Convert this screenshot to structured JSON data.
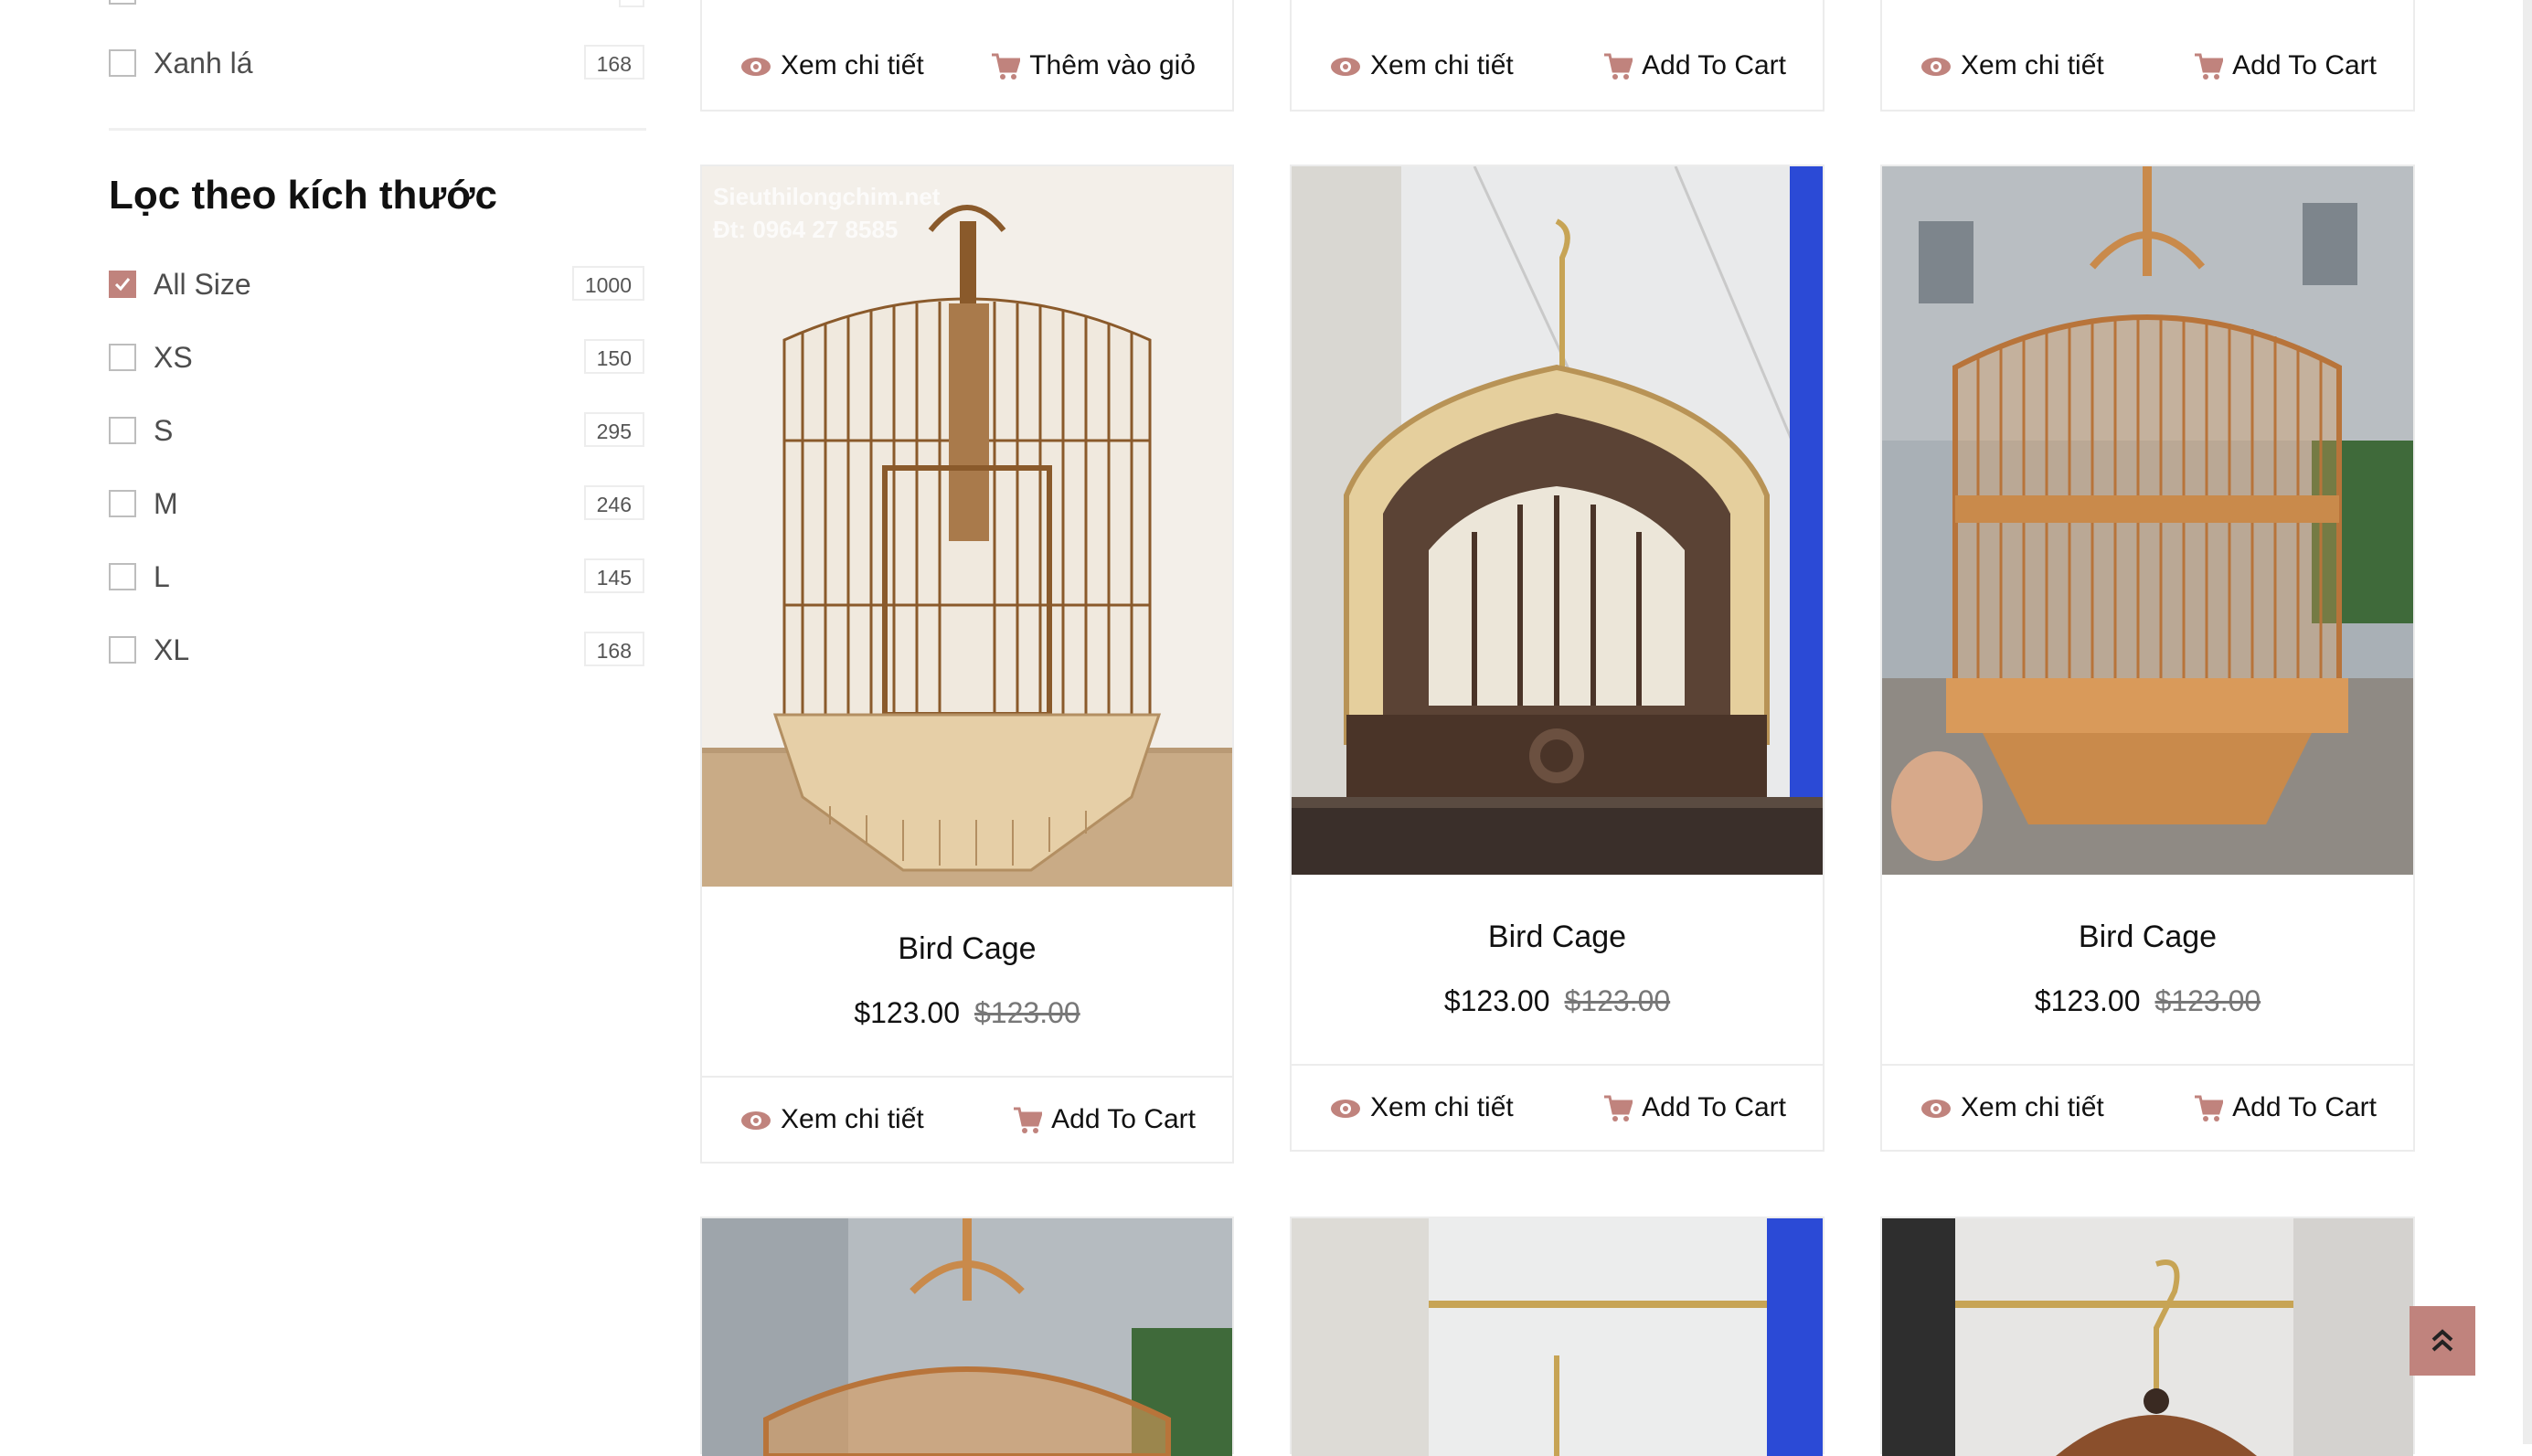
{
  "colors": {
    "accent": "#c0837d",
    "text": "#111111",
    "muted": "#777777",
    "border": "#ececec"
  },
  "sidebar": {
    "color_filter_tail": {
      "label": "Xanh lá",
      "count": "168"
    },
    "size_filter": {
      "title": "Lọc theo kích thước",
      "items": [
        {
          "label": "All Size",
          "count": "1000",
          "checked": true
        },
        {
          "label": "XS",
          "count": "150",
          "checked": false
        },
        {
          "label": "S",
          "count": "295",
          "checked": false
        },
        {
          "label": "M",
          "count": "246",
          "checked": false
        },
        {
          "label": "L",
          "count": "145",
          "checked": false
        },
        {
          "label": "XL",
          "count": "168",
          "checked": false
        }
      ]
    }
  },
  "top_row_actions": [
    {
      "view_label": "Xem chi tiết",
      "cart_label": "Thêm vào giỏ"
    },
    {
      "view_label": "Xem chi tiết",
      "cart_label": "Add To Cart"
    },
    {
      "view_label": "Xem chi tiết",
      "cart_label": "Add To Cart"
    }
  ],
  "products": [
    {
      "image_watermark": [
        "Sieuthilongchim.net",
        "Đt: 0964 27 8585"
      ],
      "name": "Bird Cage",
      "price": "$123.00",
      "old_price": "$123.00",
      "view_label": "Xem chi tiết",
      "cart_label": "Add To Cart"
    },
    {
      "name": "Bird Cage",
      "price": "$123.00",
      "old_price": "$123.00",
      "view_label": "Xem chi tiết",
      "cart_label": "Add To Cart"
    },
    {
      "name": "Bird Cage",
      "price": "$123.00",
      "old_price": "$123.00",
      "view_label": "Xem chi tiết",
      "cart_label": "Add To Cart"
    }
  ],
  "icons": {
    "view": "eye-icon",
    "cart": "cart-icon",
    "scroll_top": "double-chevron-up-icon",
    "checkbox_checked": "check-icon"
  }
}
